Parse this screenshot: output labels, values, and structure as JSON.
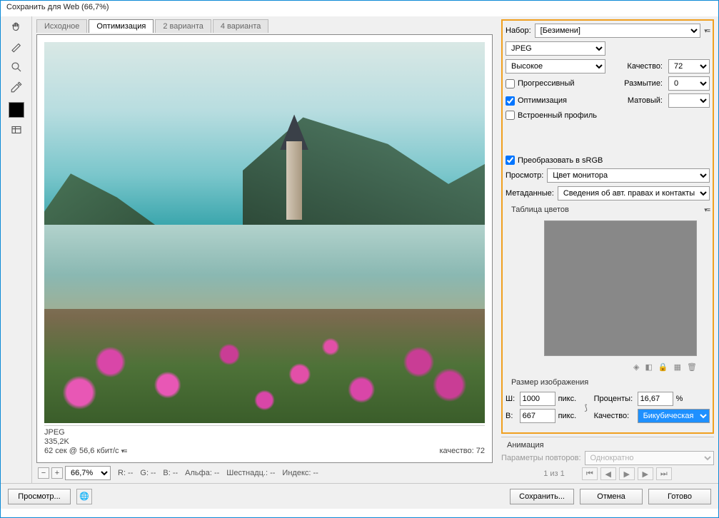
{
  "title": "Сохранить для Web (66,7%)",
  "tabs": [
    "Исходное",
    "Оптимизация",
    "2 варианта",
    "4 варианта"
  ],
  "active_tab": 1,
  "info": {
    "format": "JPEG",
    "size": "335,2K",
    "time": "62 сек @ 56,6 кбит/с",
    "quality_lbl": "качество: 72"
  },
  "zoom": "66,7%",
  "readout": {
    "r": "R: --",
    "g": "G: --",
    "b": "B: --",
    "alpha": "Альфа: --",
    "hex": "Шестнадц.: --",
    "index": "Индекс: --"
  },
  "preset": {
    "label": "Набор:",
    "value": "[Безимени]"
  },
  "format": {
    "value": "JPEG"
  },
  "quality_preset": "Высокое",
  "quality": {
    "label": "Качество:",
    "value": "72"
  },
  "blur": {
    "label": "Размытие:",
    "value": "0"
  },
  "matte": {
    "label": "Матовый:"
  },
  "checks": {
    "progressive": "Прогрессивный",
    "optimize": "Оптимизация",
    "embed": "Встроенный профиль",
    "srgb": "Преобразовать в sRGB"
  },
  "preview": {
    "label": "Просмотр:",
    "value": "Цвет монитора"
  },
  "metadata": {
    "label": "Метаданные:",
    "value": "Сведения об авт. правах и контакты"
  },
  "color_table": "Таблица цветов",
  "image_size": {
    "title": "Размер изображения",
    "w_lbl": "Ш:",
    "w": "1000",
    "h_lbl": "В:",
    "h": "667",
    "px": "пикс.",
    "percent_lbl": "Проценты:",
    "percent": "16,67",
    "q_lbl": "Качество:",
    "q": "Бикубическая"
  },
  "anim": {
    "title": "Анимация",
    "repeat_lbl": "Параметры повторов:",
    "repeat": "Однократно",
    "pos": "1 из 1"
  },
  "footer": {
    "preview": "Просмотр...",
    "save": "Сохранить...",
    "cancel": "Отмена",
    "done": "Готово"
  }
}
